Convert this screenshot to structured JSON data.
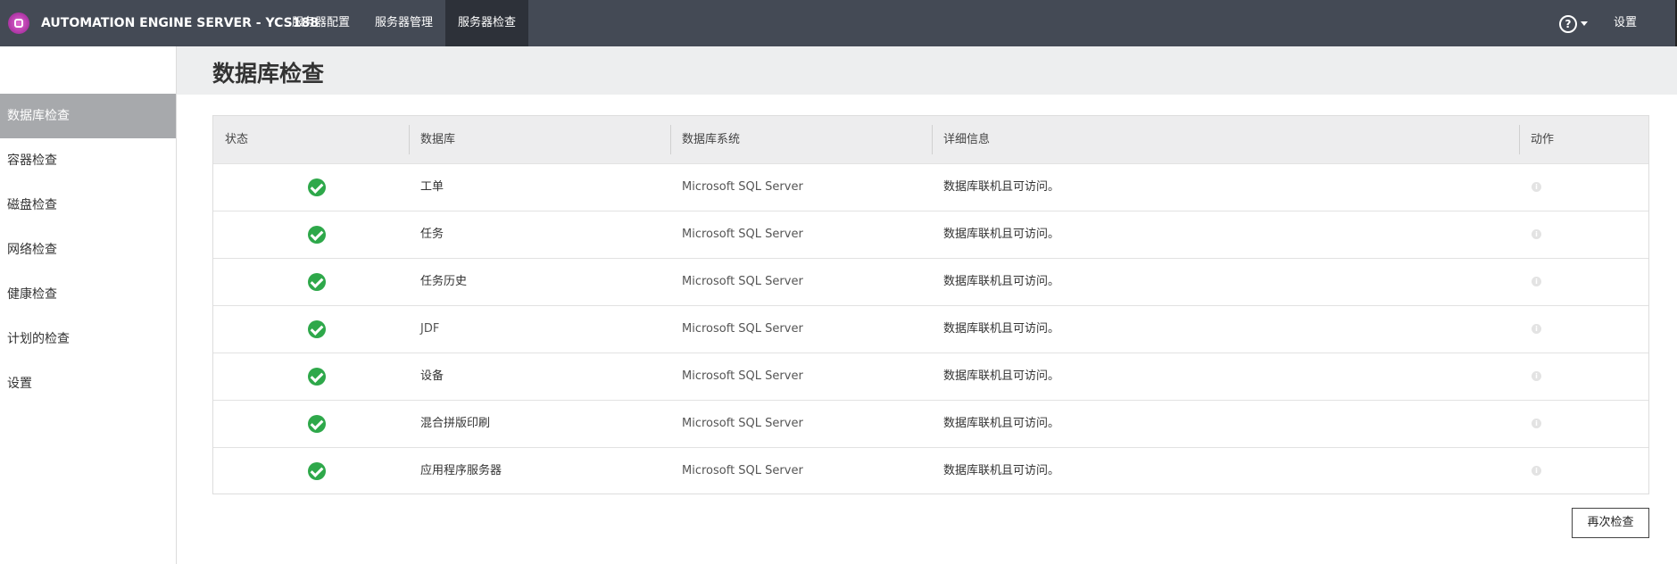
{
  "app": {
    "title": "AUTOMATION ENGINE SERVER - YCS188"
  },
  "nav": {
    "tabs": [
      {
        "label": "服务器配置",
        "active": false
      },
      {
        "label": "服务器管理",
        "active": false
      },
      {
        "label": "服务器检查",
        "active": true
      }
    ],
    "help_icon": "?",
    "settings_label": "设置"
  },
  "sidebar": {
    "items": [
      {
        "label": "数据库检查",
        "active": true
      },
      {
        "label": "容器检查",
        "active": false
      },
      {
        "label": "磁盘检查",
        "active": false
      },
      {
        "label": "网络检查",
        "active": false
      },
      {
        "label": "健康检查",
        "active": false
      },
      {
        "label": "计划的检查",
        "active": false
      },
      {
        "label": "设置",
        "active": false
      }
    ]
  },
  "page": {
    "title": "数据库检查"
  },
  "table": {
    "headers": [
      "状态",
      "数据库",
      "数据库系统",
      "详细信息",
      "动作"
    ],
    "rows": [
      {
        "status": "ok",
        "database": "工单",
        "system": "Microsoft SQL Server",
        "details": "数据库联机且可访问。"
      },
      {
        "status": "ok",
        "database": "任务",
        "system": "Microsoft SQL Server",
        "details": "数据库联机且可访问。"
      },
      {
        "status": "ok",
        "database": "任务历史",
        "system": "Microsoft SQL Server",
        "details": "数据库联机且可访问。"
      },
      {
        "status": "ok",
        "database": "JDF",
        "system": "Microsoft SQL Server",
        "details": "数据库联机且可访问。"
      },
      {
        "status": "ok",
        "database": "设备",
        "system": "Microsoft SQL Server",
        "details": "数据库联机且可访问。"
      },
      {
        "status": "ok",
        "database": "混合拼版印刷",
        "system": "Microsoft SQL Server",
        "details": "数据库联机且可访问。"
      },
      {
        "status": "ok",
        "database": "应用程序服务器",
        "system": "Microsoft SQL Server",
        "details": "数据库联机且可访问。"
      }
    ],
    "action_icon": "i"
  },
  "buttons": {
    "recheck_label": "再次检查"
  },
  "colors": {
    "topbar": "#444a55",
    "active_tab": "#2d3139",
    "ok_green": "#2ea84a",
    "sidebar_active": "#a7a9ac"
  }
}
